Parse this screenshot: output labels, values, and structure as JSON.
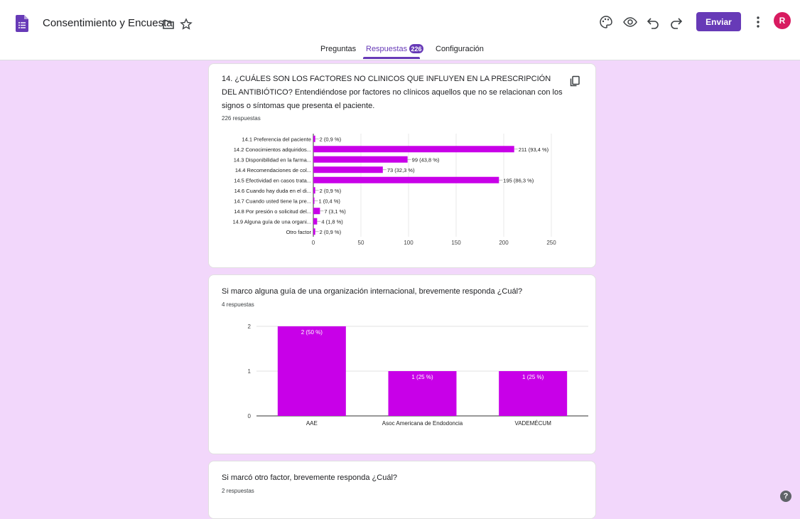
{
  "header": {
    "doc_title": "Consentimiento y Encuesta",
    "send_label": "Enviar",
    "avatar_letter": "R",
    "accent_color": "#673ab7"
  },
  "tabs": {
    "questions": "Preguntas",
    "responses": "Respuestas",
    "responses_count": "226",
    "settings": "Configuración"
  },
  "cards": [
    {
      "title": "14. ¿CUÁLES SON LOS FACTORES NO CLINICOS QUE INFLUYEN EN LA PRESCRIPCIÓN DEL ANTIBIÓTICO? Entendiéndose por factores no clínicos aquellos que no se relacionan con los signos o síntomas que presenta el paciente.",
      "responses": "226 respuestas"
    },
    {
      "title": "Si marco alguna guía de una organización internacional, brevemente responda ¿Cuál?",
      "responses": "4 respuestas"
    },
    {
      "title": "Si marcó otro factor, brevemente responda ¿Cuál?",
      "responses": "2 respuestas"
    }
  ],
  "chart_data": [
    {
      "type": "bar",
      "orientation": "horizontal",
      "bar_color": "#c800e8",
      "categories": [
        "14.1 Preferencia del paciente",
        "14.2 Conocimientos adquiridos...",
        "14.3 Disponibilidad en la farma...",
        "14.4 Recomendaciones de col...",
        "14.5 Efectividad en casos trata...",
        "14.6 Cuando hay duda en el di...",
        "14.7 Cuando usted tiene la pre...",
        "14.8 Por presión o solicitud del...",
        "14.9 Alguna guía de una organi...",
        "Otro factor"
      ],
      "values": [
        2,
        211,
        99,
        73,
        195,
        2,
        1,
        7,
        4,
        2
      ],
      "data_labels": [
        "2 (0,9 %)",
        "211 (93,4 %)",
        "99 (43,8 %)",
        "73 (32,3 %)",
        "195 (86,3 %)",
        "2 (0,9 %)",
        "1 (0,4 %)",
        "7 (3,1 %)",
        "4 (1,8 %)",
        "2 (0,9 %)"
      ],
      "xlim": [
        0,
        250
      ],
      "xticks": [
        "0",
        "50",
        "100",
        "150",
        "200",
        "250"
      ],
      "grid": true
    },
    {
      "type": "bar",
      "orientation": "vertical",
      "bar_color": "#c800e8",
      "categories": [
        "AAE",
        "Asoc Americana de Endodoncia",
        "VADEMÉCUM"
      ],
      "values": [
        2,
        1,
        1
      ],
      "data_labels": [
        "2 (50 %)",
        "1 (25 %)",
        "1 (25 %)"
      ],
      "ylim": [
        0,
        2
      ],
      "yticks": [
        "0",
        "1",
        "2"
      ],
      "grid": true
    }
  ]
}
